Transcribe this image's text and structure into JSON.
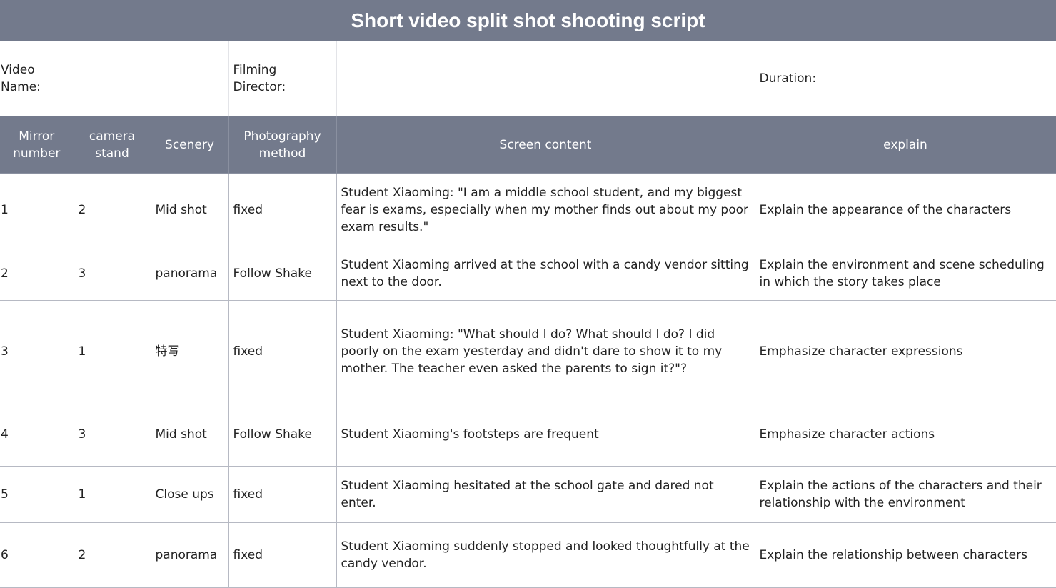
{
  "title": "Short video split shot shooting script",
  "info": {
    "video_name_label": "Video Name:",
    "video_name_value": "",
    "filming_director_label": "Filming Director:",
    "filming_director_value": "",
    "duration_label": "Duration:"
  },
  "columns": [
    "Mirror number",
    "camera stand",
    "Scenery",
    "Photography method",
    "Screen content",
    "explain"
  ],
  "rows": [
    {
      "mirror": "1",
      "stand": "2",
      "scenery": "Mid shot",
      "method": "fixed",
      "content": "Student Xiaoming: \"I am a middle school student, and my biggest fear is exams, especially when my mother finds out about my poor exam results.\"",
      "explain": "Explain the appearance of the characters"
    },
    {
      "mirror": "2",
      "stand": "3",
      "scenery": "panorama",
      "method": "Follow Shake",
      "content": "Student Xiaoming arrived at the school with a candy vendor sitting next to the door.",
      "explain": "Explain the environment and scene scheduling in which the story takes place"
    },
    {
      "mirror": "3",
      "stand": "1",
      "scenery": "特写",
      "method": "fixed",
      "content": "Student Xiaoming: \"What should I do? What should I do? I did poorly on the exam yesterday and didn't dare to show it to my mother. The teacher even asked the parents to sign it?\"?",
      "explain": "Emphasize character expressions"
    },
    {
      "mirror": "4",
      "stand": "3",
      "scenery": "Mid shot",
      "method": "Follow Shake",
      "content": "Student Xiaoming's footsteps are frequent",
      "explain": "Emphasize character actions"
    },
    {
      "mirror": "5",
      "stand": "1",
      "scenery": "Close ups",
      "method": "fixed",
      "content": "Student Xiaoming hesitated at the school gate and dared not enter.",
      "explain": "Explain the actions of the characters and their relationship with the environment"
    },
    {
      "mirror": "6",
      "stand": "2",
      "scenery": "panorama",
      "method": "fixed",
      "content": "Student Xiaoming suddenly stopped and looked thoughtfully at the candy vendor.",
      "explain": "Explain the relationship between characters"
    }
  ]
}
